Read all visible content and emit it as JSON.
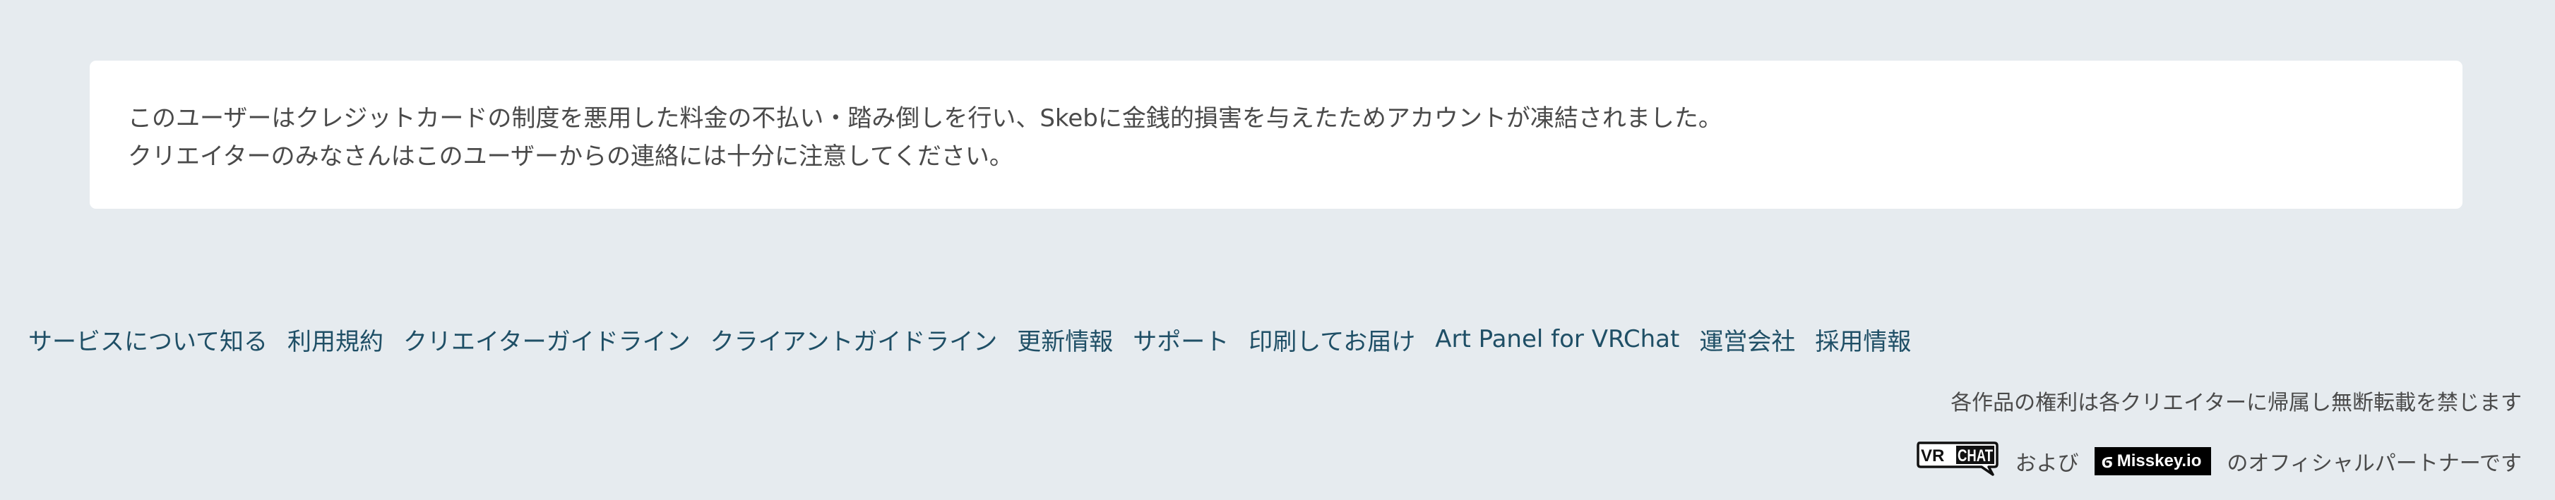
{
  "notice": {
    "line1": "このユーザーはクレジットカードの制度を悪用した料金の不払い・踏み倒しを行い、Skebに金銭的損害を与えたためアカウントが凍結されました。",
    "line2": "クリエイターのみなさんはこのユーザーからの連絡には十分に注意してください。"
  },
  "footer": {
    "links": [
      "サービスについて知る",
      "利用規約",
      "クリエイターガイドライン",
      "クライアントガイドライン",
      "更新情報",
      "サポート",
      "印刷してお届け",
      "Art Panel for VRChat",
      "運営会社",
      "採用情報"
    ],
    "copyright": "各作品の権利は各クリエイターに帰属し無断転載を禁じます",
    "partner": {
      "vrchat_logo_text": "VRCHAT",
      "and_text": "および",
      "misskey_logo_text": "Misskey.io",
      "suffix": "のオフィシャルパートナーです"
    }
  },
  "colors": {
    "background": "#e6ebef",
    "card": "#ffffff",
    "body_text": "#4a4a4a",
    "link": "#1f4f66"
  }
}
